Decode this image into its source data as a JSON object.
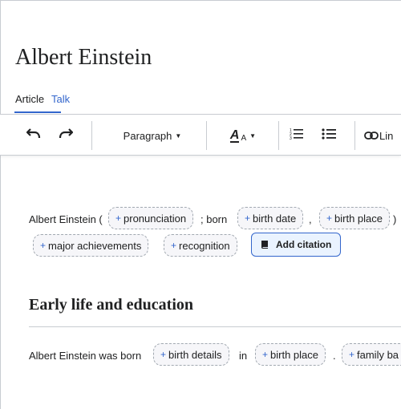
{
  "page": {
    "title": "Albert Einstein"
  },
  "tabs": [
    {
      "label": "Article",
      "active": true
    },
    {
      "label": "Talk",
      "active": false
    }
  ],
  "toolbar": {
    "undo_icon": "undo-icon",
    "redo_icon": "redo-icon",
    "paragraph_label": "Paragraph",
    "text_style_label": "A",
    "lists_icon": "numbered-list-icon",
    "bullets_icon": "bulleted-list-icon",
    "link_label": "Lin"
  },
  "lead": {
    "text_start": "Albert Einstein (",
    "chip_pronunciation": "pronunciation",
    "text_born": "; born",
    "chip_birth_date": "birth date",
    "comma": ",",
    "chip_birth_place": "birth place",
    "close_paren": ")",
    "chip_achievements": "major achievements",
    "chip_recognition": "recognition",
    "add_citation": "Add citation"
  },
  "section": {
    "heading": "Early life and education",
    "text_start": "Albert Einstein was born",
    "chip_birth_details": "birth details",
    "text_in": "in",
    "chip_birth_place": "birth place",
    "period": ".",
    "chip_family": "family ba"
  },
  "colors": {
    "accent": "#3366cc",
    "chip_bg": "#f6f6f9",
    "chip_border": "#a2a9b1",
    "cite_bg": "#eaf3ff"
  }
}
